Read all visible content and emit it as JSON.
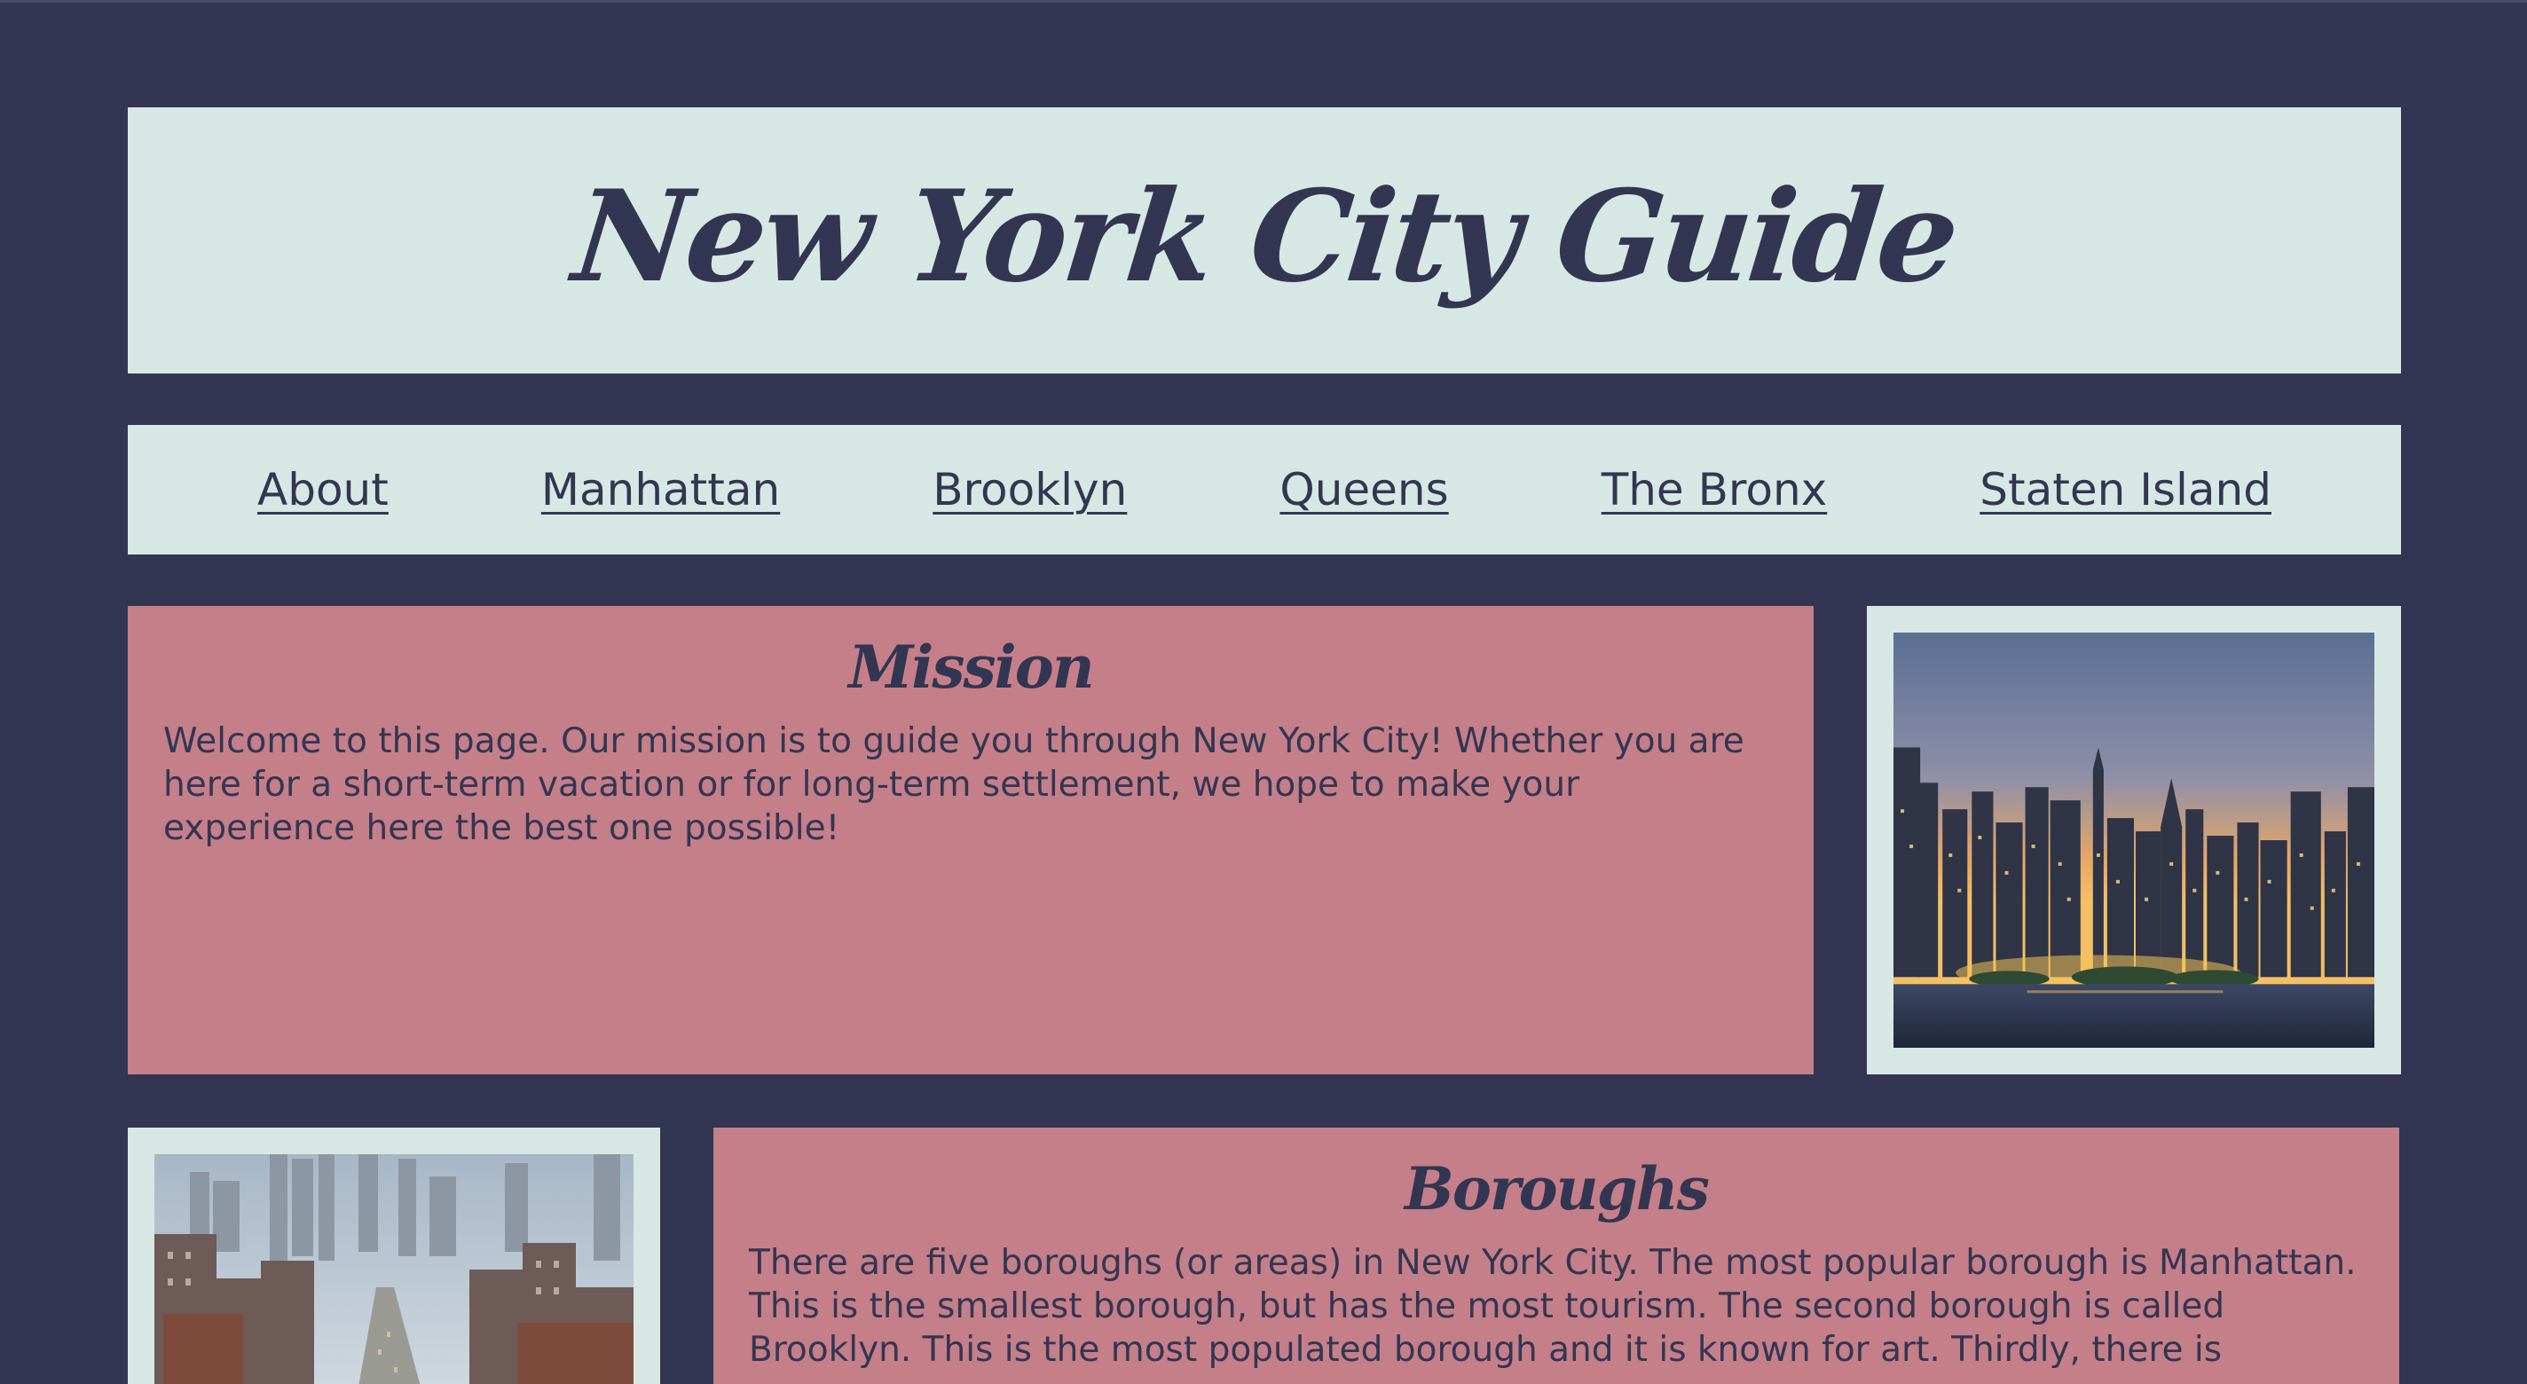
{
  "header": {
    "title": "New York City Guide"
  },
  "nav": {
    "items": [
      {
        "label": "About"
      },
      {
        "label": "Manhattan"
      },
      {
        "label": "Brooklyn"
      },
      {
        "label": "Queens"
      },
      {
        "label": "The Bronx"
      },
      {
        "label": "Staten Island"
      }
    ]
  },
  "mission": {
    "heading": "Mission",
    "text": "Welcome to this page. Our mission is to guide you through New York City! Whether you are here for a short-term vacation or for long-term settlement, we hope to make your experience here the best one possible!"
  },
  "images": {
    "skyline": "city-skyline-at-sunset-photo",
    "street": "city-street-buildings-photo"
  },
  "boroughs": {
    "heading": "Boroughs",
    "text": "There are five boroughs (or areas) in New York City. The most popular borough is Manhattan. This is the smallest borough, but has the most tourism. The second borough is called Brooklyn. This is the most populated borough and it is known for art. Thirdly, there is"
  },
  "colors": {
    "background": "#333652",
    "panel_light": "#d7e8e4",
    "panel_rose": "#c57f89",
    "text": "#333652"
  }
}
